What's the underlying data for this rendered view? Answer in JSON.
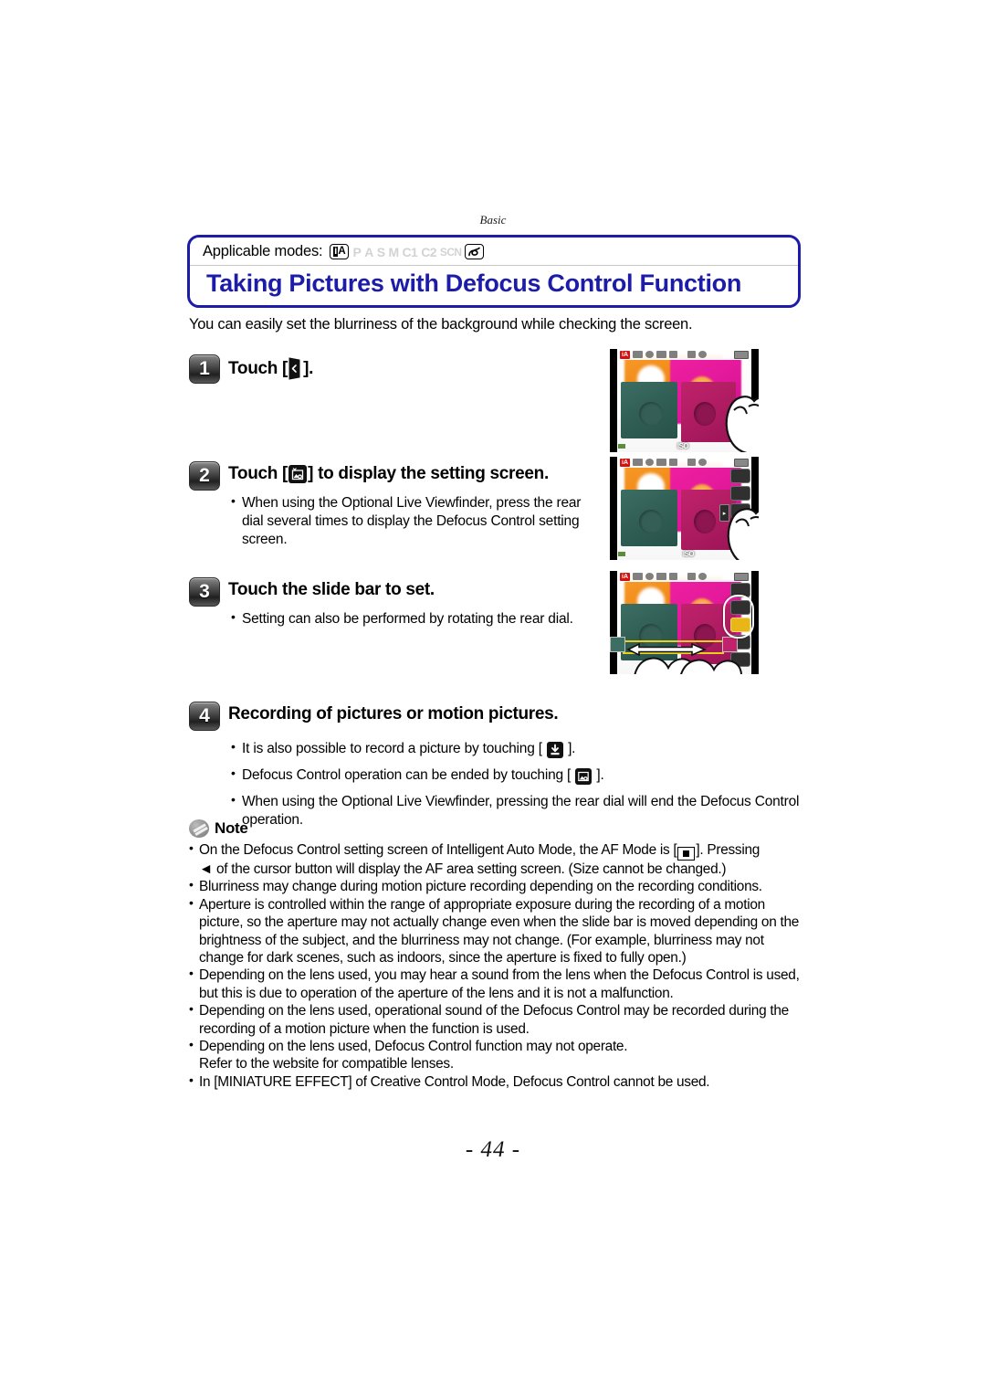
{
  "running_head": "Basic",
  "header": {
    "applicable_label": "Applicable modes:",
    "modes": [
      {
        "name": "mode-ia",
        "label": "iA",
        "active": true
      },
      {
        "name": "mode-p",
        "label": "P",
        "active": false
      },
      {
        "name": "mode-a",
        "label": "A",
        "active": false
      },
      {
        "name": "mode-s",
        "label": "S",
        "active": false
      },
      {
        "name": "mode-m",
        "label": "M",
        "active": false
      },
      {
        "name": "mode-c1",
        "label": "C1",
        "active": false
      },
      {
        "name": "mode-c2",
        "label": "C2",
        "active": false
      },
      {
        "name": "mode-scn",
        "label": "SCN",
        "active": false
      },
      {
        "name": "mode-creative-control",
        "label": "",
        "active": true
      }
    ],
    "title": "Taking Pictures with Defocus Control Function",
    "accent_color": "#1c1ca8"
  },
  "intro": "You can easily set the blurriness of the background while checking the screen.",
  "steps": [
    {
      "number": "1",
      "title_before": "Touch [",
      "title_after": "].",
      "icon": "touch-tab-icon",
      "bullets": []
    },
    {
      "number": "2",
      "title_before": "Touch [",
      "title_after": "] to display the setting screen.",
      "icon": "defocus-control-icon",
      "bullets": [
        "When using the Optional Live Viewfinder, press the rear dial several times to display the Defocus Control setting screen."
      ]
    },
    {
      "number": "3",
      "title_before": "Touch the slide bar to set.",
      "title_after": "",
      "icon": "",
      "bullets": [
        "Setting can also be performed by rotating the rear dial."
      ]
    },
    {
      "number": "4",
      "title_before": "Recording of pictures or motion pictures.",
      "title_after": "",
      "icon": "",
      "bullets": []
    }
  ],
  "step4_bullets": {
    "b1_before": "It is also possible to record a picture by touching [",
    "b1_after": "].",
    "b1_icon": "shutter-record-icon",
    "b2_before": "Defocus Control operation can be ended by touching [",
    "b2_after": "].",
    "b2_icon": "defocus-control-off-icon",
    "b3": "When using the Optional Live Viewfinder, pressing the rear dial will end the Defocus Control operation."
  },
  "note": {
    "title": "Note",
    "icon": "note-pencil-icon",
    "items": [
      {
        "parts": [
          "On the Defocus Control setting screen of Intelligent Auto Mode, the AF Mode is [",
          "af-mode-icon",
          "]. Pressing"
        ],
        "cont": "◄ of the cursor button will display the AF area setting screen. (Size cannot be changed.)"
      },
      {
        "text": "Blurriness may change during motion picture recording depending on the recording conditions."
      },
      {
        "text": "Aperture is controlled within the range of appropriate exposure during the recording of a motion picture, so the aperture may not actually change even when the slide bar is moved depending on the brightness of the subject, and the blurriness may not change. (For example, blurriness may not change for dark scenes, such as indoors, since the aperture is fixed to fully open.)"
      },
      {
        "text": "Depending on the lens used, you may hear a sound from the lens when the Defocus Control is used, but this is due to operation of the aperture of the lens and it is not a malfunction."
      },
      {
        "text": "Depending on the lens used, operational sound of the Defocus Control may be recorded during the recording of a motion picture when the function is used."
      },
      {
        "text": "Depending on the lens used, Defocus Control function may not operate.",
        "cont": "Refer to the website for compatible lenses."
      },
      {
        "text": "In [MINIATURE EFFECT] of Creative Control Mode, Defocus Control cannot be used."
      }
    ]
  },
  "figures": {
    "fig1": {
      "name": "lcd-touch-right-edge",
      "osd_iso": "ISO",
      "osd_mode": "iA"
    },
    "fig2": {
      "name": "lcd-touch-tab-menu",
      "osd_iso": "ISO",
      "osd_mode": "iA"
    },
    "fig3": {
      "name": "lcd-slide-bar",
      "osd_iso": "ISO",
      "osd_mode": "iA"
    }
  },
  "page_number": "- 44 -"
}
